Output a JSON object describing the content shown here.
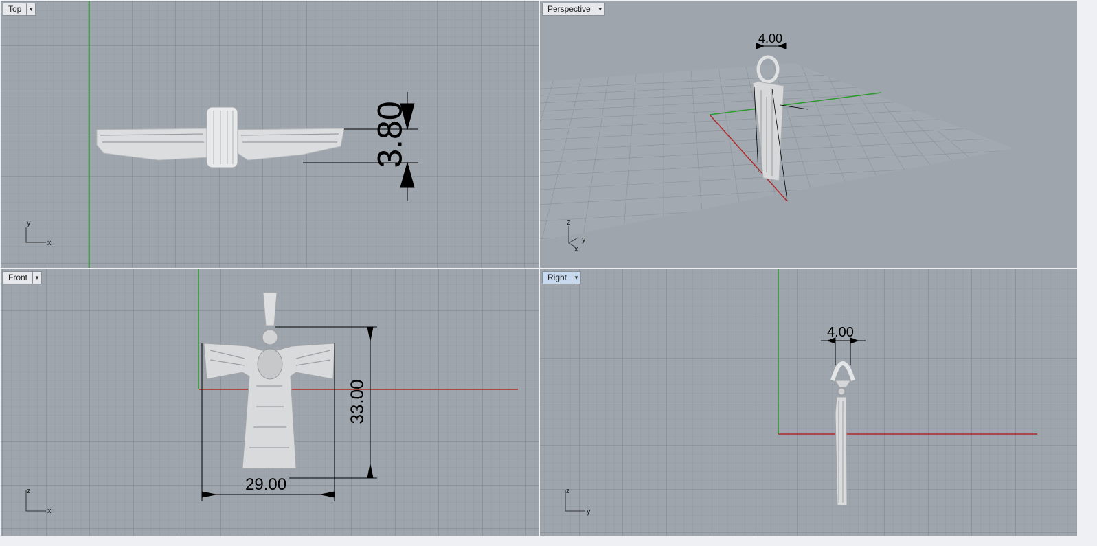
{
  "viewports": {
    "top": {
      "name": "Top"
    },
    "perspective": {
      "name": "Perspective"
    },
    "front": {
      "name": "Front"
    },
    "right": {
      "name": "Right"
    }
  },
  "dimensions": {
    "top_depth": "3.80",
    "perspective_width": "4.00",
    "front_height": "33.00",
    "front_width": "29.00",
    "right_width": "4.00"
  },
  "axis_labels": {
    "top": {
      "v": "y",
      "h": "x"
    },
    "perspective": {
      "v": "z",
      "h": "y",
      "d": "x"
    },
    "front": {
      "v": "z",
      "h": "x"
    },
    "right": {
      "v": "z",
      "h": "y"
    }
  },
  "colors": {
    "viewport_bg": "#9ea5ad",
    "grid_minor": "#8f969e",
    "grid_major": "#7e858d",
    "x_axis": "#b02a2a",
    "y_axis": "#2c9a2c",
    "model": "#e4e5e6",
    "active_tab": "#c7d9ee"
  },
  "icons": {
    "dropdown": "triangle-down-icon"
  }
}
